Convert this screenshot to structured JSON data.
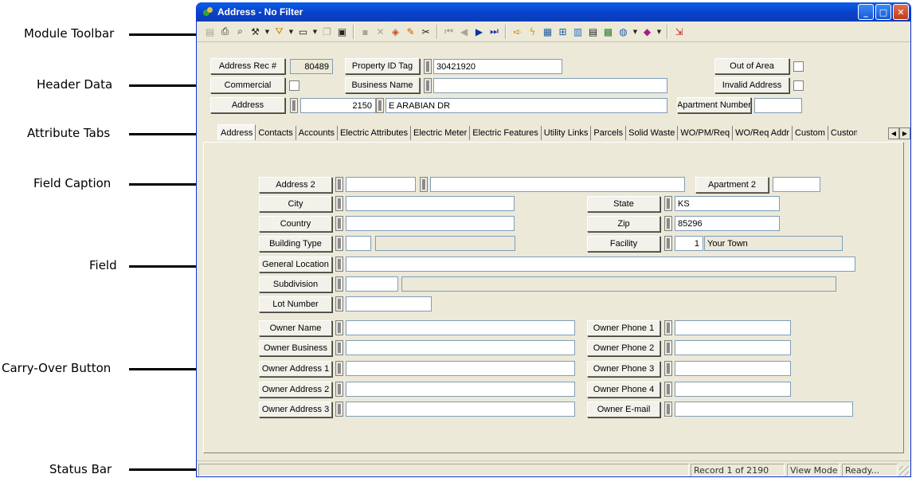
{
  "callouts": {
    "module_toolbar": "Module Toolbar",
    "header_data": "Header Data",
    "attribute_tabs": "Attribute Tabs",
    "field_caption": "Field Caption",
    "field": "Field",
    "carry_over_button": "Carry-Over Button",
    "status_bar": "Status Bar"
  },
  "window": {
    "title": "Address - No Filter",
    "minimize": "_",
    "maximize": "□",
    "close": "✕"
  },
  "toolbar_icons": [
    "record-icon",
    "printer-icon",
    "zoom-icon",
    "tools-icon",
    "filter-icon",
    "document-icon",
    "copy-record-icon",
    "save-icon",
    "delete-icon",
    "eraser-icon",
    "pencil-icon",
    "cut-icon",
    "first-record-icon",
    "previous-record-icon",
    "next-record-icon",
    "last-record-icon",
    "arrow-icon",
    "lightning-icon",
    "map-icon",
    "tree-icon",
    "chart-icon",
    "calculator-icon",
    "image-icon",
    "globe-icon",
    "tag-icon",
    "exit-icon"
  ],
  "header": {
    "address_rec_label": "Address Rec #",
    "address_rec_value": "80489",
    "property_id_label": "Property ID Tag",
    "property_id_value": "30421920",
    "out_of_area_label": "Out of Area",
    "commercial_label": "Commercial",
    "business_name_label": "Business Name",
    "business_name_value": "",
    "invalid_address_label": "Invalid Address",
    "address_label": "Address",
    "street_number": "2150",
    "street_name": "E ARABIAN DR",
    "apartment_number_label": "Apartment Number",
    "apartment_number_value": ""
  },
  "tabs": [
    "Address",
    "Contacts",
    "Accounts",
    "Electric Attributes",
    "Electric Meter",
    "Electric Features",
    "Utility Links",
    "Parcels",
    "Solid Waste",
    "WO/PM/Req",
    "WO/Req Addr",
    "Custom",
    "Custom"
  ],
  "active_tab": "Address",
  "form": {
    "address2_label": "Address 2",
    "apartment2_label": "Apartment 2",
    "city_label": "City",
    "city_value": "",
    "state_label": "State",
    "state_value": "KS",
    "country_label": "Country",
    "country_value": "",
    "zip_label": "Zip",
    "zip_value": "85296",
    "building_type_label": "Building Type",
    "facility_label": "Facility",
    "facility_number": "1",
    "facility_name": "Your Town",
    "general_location_label": "General Location",
    "subdivision_label": "Subdivision",
    "lot_number_label": "Lot Number",
    "owner_name_label": "Owner Name",
    "owner_business_label": "Owner Business",
    "owner_address1_label": "Owner Address 1",
    "owner_address2_label": "Owner Address 2",
    "owner_address3_label": "Owner Address 3",
    "owner_phone1_label": "Owner Phone 1",
    "owner_phone2_label": "Owner Phone 2",
    "owner_phone3_label": "Owner Phone 3",
    "owner_phone4_label": "Owner Phone 4",
    "owner_email_label": "Owner E-mail"
  },
  "status": {
    "record": "Record 1 of 2190",
    "mode": "View Mode",
    "state": "Ready..."
  },
  "colors": {
    "titlebar": "#0a5ce7",
    "window_bg": "#ece9d8",
    "field_border": "#7f9db9"
  }
}
